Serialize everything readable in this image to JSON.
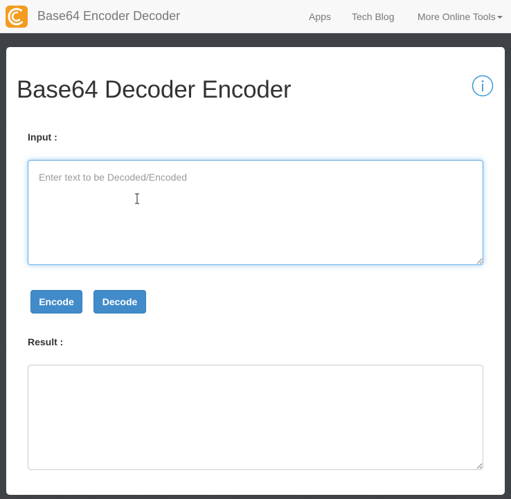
{
  "navbar": {
    "brand_title": "Base64 Encoder Decoder",
    "links": [
      "Apps",
      "Tech Blog",
      "More Online Tools"
    ]
  },
  "main": {
    "title": "Base64 Decoder Encoder",
    "input_label": "Input :",
    "input_placeholder": "Enter text to be Decoded/Encoded",
    "input_value": "",
    "encode_label": "Encode",
    "decode_label": "Decode",
    "result_label": "Result :",
    "result_value": ""
  },
  "colors": {
    "brand_orange": "#f39c1f",
    "primary_button": "#428bca",
    "focus_border": "#66afe9",
    "info_icon": "#3a9ad9"
  },
  "icons": [
    "app-logo-icon",
    "chevron-down-icon",
    "info-icon",
    "text-cursor-icon"
  ]
}
